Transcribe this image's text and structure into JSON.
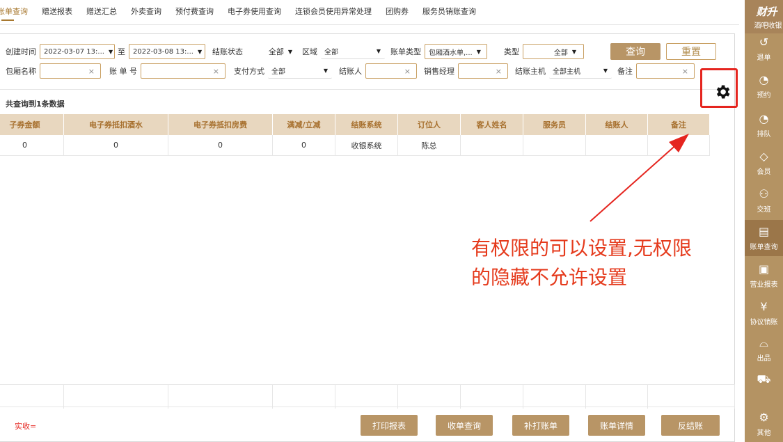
{
  "tabs": [
    "账单查询",
    "赠送报表",
    "赠送汇总",
    "外卖查询",
    "预付费查询",
    "电子券使用查询",
    "连锁会员使用异常处理",
    "团购券",
    "服务员销账查询"
  ],
  "filters": {
    "create_time_label": "创建时间",
    "create_time_start": "2022-03-07 13:...",
    "to_label": "至",
    "create_time_end": "2022-03-08 13:...",
    "settle_status_label": "结账状态",
    "settle_status_value": "全部",
    "area_label": "区域",
    "area_value": "全部",
    "bill_type_label": "账单类型",
    "bill_type_value": "包厢酒水单,...",
    "type_label": "类型",
    "type_value": "全部",
    "query_button": "查询",
    "reset_button": "重置",
    "room_name_label": "包厢名称",
    "bill_no_label": "账 单 号",
    "pay_method_label": "支付方式",
    "pay_method_value": "全部",
    "cashier_label": "结账人",
    "sales_manager_label": "销售经理",
    "settle_host_label": "结账主机",
    "settle_host_value": "全部主机",
    "remark_label": "备注"
  },
  "count_text": "共查询到1条数据",
  "table": {
    "headers": [
      "子券金额",
      "电子券抵扣酒水",
      "电子券抵扣房费",
      "满减/立减",
      "结账系统",
      "订位人",
      "客人姓名",
      "服务员",
      "结账人",
      "备注"
    ],
    "rows": [
      [
        "0",
        "0",
        "0",
        "0",
        "收银系统",
        "陈总",
        "",
        "",
        "",
        ""
      ]
    ]
  },
  "annotation": [
    "有权限的可以设置,无权限",
    "的隐藏不允许设置"
  ],
  "colors": {
    "accent": "#b89566",
    "header_bg": "#e8d7bf",
    "header_text": "#a7702e",
    "annotation": "#e53a1c",
    "highlight_box": "#e5251f"
  },
  "footer": {
    "actual_label": "实收=",
    "buttons": [
      "打印报表",
      "收单查询",
      "补打账单",
      "账单详情",
      "反结账"
    ]
  },
  "sidebar": {
    "brand": "财升",
    "brand_sub": "酒吧收银",
    "items": [
      {
        "icon": "refund-icon",
        "label": "退单"
      },
      {
        "icon": "clock-icon",
        "label": "预约"
      },
      {
        "icon": "clock-icon",
        "label": "排队"
      },
      {
        "icon": "diamond-icon",
        "label": "会员"
      },
      {
        "icon": "shift-icon",
        "label": "交班"
      },
      {
        "icon": "bill-icon",
        "label": "账单查询"
      },
      {
        "icon": "report-icon",
        "label": "营业报表"
      },
      {
        "icon": "yen-icon",
        "label": "协议销账"
      },
      {
        "icon": "dish-icon",
        "label": "出品"
      },
      {
        "icon": "cart-icon",
        "label": ""
      },
      {
        "icon": "gear-icon",
        "label": "其他"
      }
    ]
  }
}
